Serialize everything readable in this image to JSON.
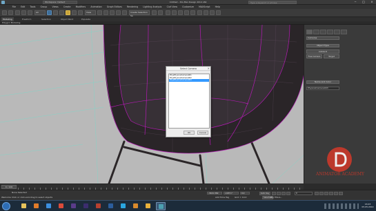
{
  "window": {
    "title": "Untitled - 3ds Max Design 2014 x64",
    "workspace": "Workspace: Default",
    "search_placeholder": "Type a keyword or phrase"
  },
  "menu": [
    "File",
    "Edit",
    "Tools",
    "Group",
    "Views",
    "Create",
    "Modifiers",
    "Animation",
    "Graph Editors",
    "Rendering",
    "Lighting Analysis",
    "Civil View",
    "Customize",
    "MAXScript",
    "Help"
  ],
  "toolbar": {
    "selection_filter": "All",
    "view_combo": "View",
    "selection_set": "Create Selection Se"
  },
  "ribbon": {
    "tabs": [
      "Modeling",
      "Freeform",
      "Selection",
      "Object Paint",
      "Populate"
    ],
    "sub_label": "Polygon Modeling"
  },
  "dialog": {
    "title": "Select Camera",
    "items": [
      "PhysPhysicalCamera001",
      "PhysPhysicalCamera002",
      "PhysPhysicalCamera003"
    ],
    "selected_index": 2,
    "ok": "OK",
    "cancel": "Cancel"
  },
  "command_panel": {
    "dropdown": "Cameras",
    "rollout_object_type": "Object Type",
    "autogrid": "AutoGrid",
    "button_freecam": "Free Camera",
    "button_target": "Target",
    "rollout_name_color": "Name and Color",
    "name_value": "PhysicalCamera003"
  },
  "timeline": {
    "frame": "0 / 100"
  },
  "status": {
    "objects_selected": "None Selected",
    "prompt": "Click or click-and-drag to select objects",
    "welcome": "Welcome to M",
    "x_value": "-3421.369",
    "y_value": "-1037.7",
    "z_value": "0.0",
    "grid": "Grid = 10.0",
    "auto_key": "Auto Key",
    "set_key": "Set Key",
    "selected": "Selected",
    "key_filters": "Key Filters...",
    "add_time_tag": "Add Time Tag",
    "frame_value": "0"
  },
  "watermark": {
    "text": "ANIMATOR ACADEMY",
    "color": "#c8392b"
  },
  "taskbar": {
    "time": "16:23",
    "date": "05.05.2014"
  },
  "colors": {
    "viewport_bg": "#b9b9b9",
    "chair_magenta": "#c418c4",
    "chair_body": "#2a2528",
    "grid_line": "#7fd6c8",
    "dialog_selected": "#3399ff",
    "watermark_red": "#c8392b"
  }
}
